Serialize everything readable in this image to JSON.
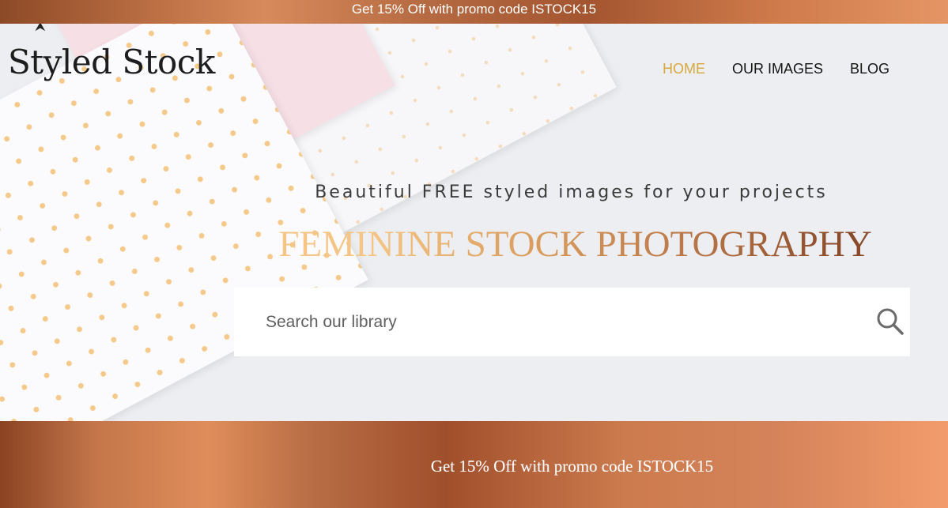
{
  "promo_top": {
    "text": "Get 15% Off with promo code ISTOCK15"
  },
  "header": {
    "logo": "Styled Stock",
    "nav": [
      {
        "label": "HOME",
        "active": true
      },
      {
        "label": "OUR IMAGES",
        "active": false
      },
      {
        "label": "BLOG",
        "active": false
      }
    ]
  },
  "hero": {
    "tagline": "Beautiful FREE styled images for your projects",
    "headline": "FEMININE STOCK PHOTOGRAPHY",
    "search": {
      "placeholder": "Search our library",
      "value": "",
      "icon": "search-icon"
    }
  },
  "promo_bottom": {
    "text": "Get 15% Off with promo code ISTOCK15"
  },
  "colors": {
    "accent_gold": "#d8a840",
    "copper": "#b86d44",
    "text_dark": "#151515"
  }
}
